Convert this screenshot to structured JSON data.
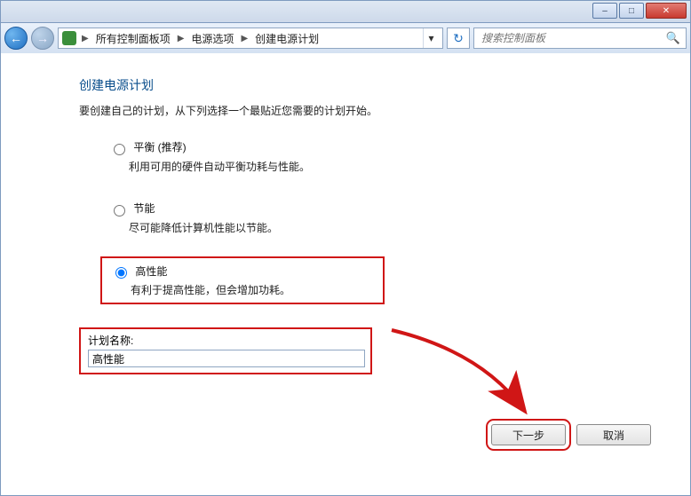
{
  "window": {
    "min_tip": "–",
    "max_tip": "□",
    "close_tip": "✕"
  },
  "nav": {
    "crumb_icon": "power-icon",
    "crumb1": "所有控制面板项",
    "crumb2": "电源选项",
    "crumb3": "创建电源计划",
    "search_placeholder": "搜索控制面板"
  },
  "page": {
    "title": "创建电源计划",
    "instruction": "要创建自己的计划，从下列选择一个最贴近您需要的计划开始。",
    "name_label": "计划名称:",
    "name_value": "高性能"
  },
  "plans": [
    {
      "id": "balanced",
      "name": "平衡 (推荐)",
      "desc": "利用可用的硬件自动平衡功耗与性能。",
      "checked": false
    },
    {
      "id": "saver",
      "name": "节能",
      "desc": "尽可能降低计算机性能以节能。",
      "checked": false
    },
    {
      "id": "high",
      "name": "高性能",
      "desc": "有利于提高性能，但会增加功耗。",
      "checked": true
    }
  ],
  "buttons": {
    "next": "下一步",
    "cancel": "取消"
  }
}
